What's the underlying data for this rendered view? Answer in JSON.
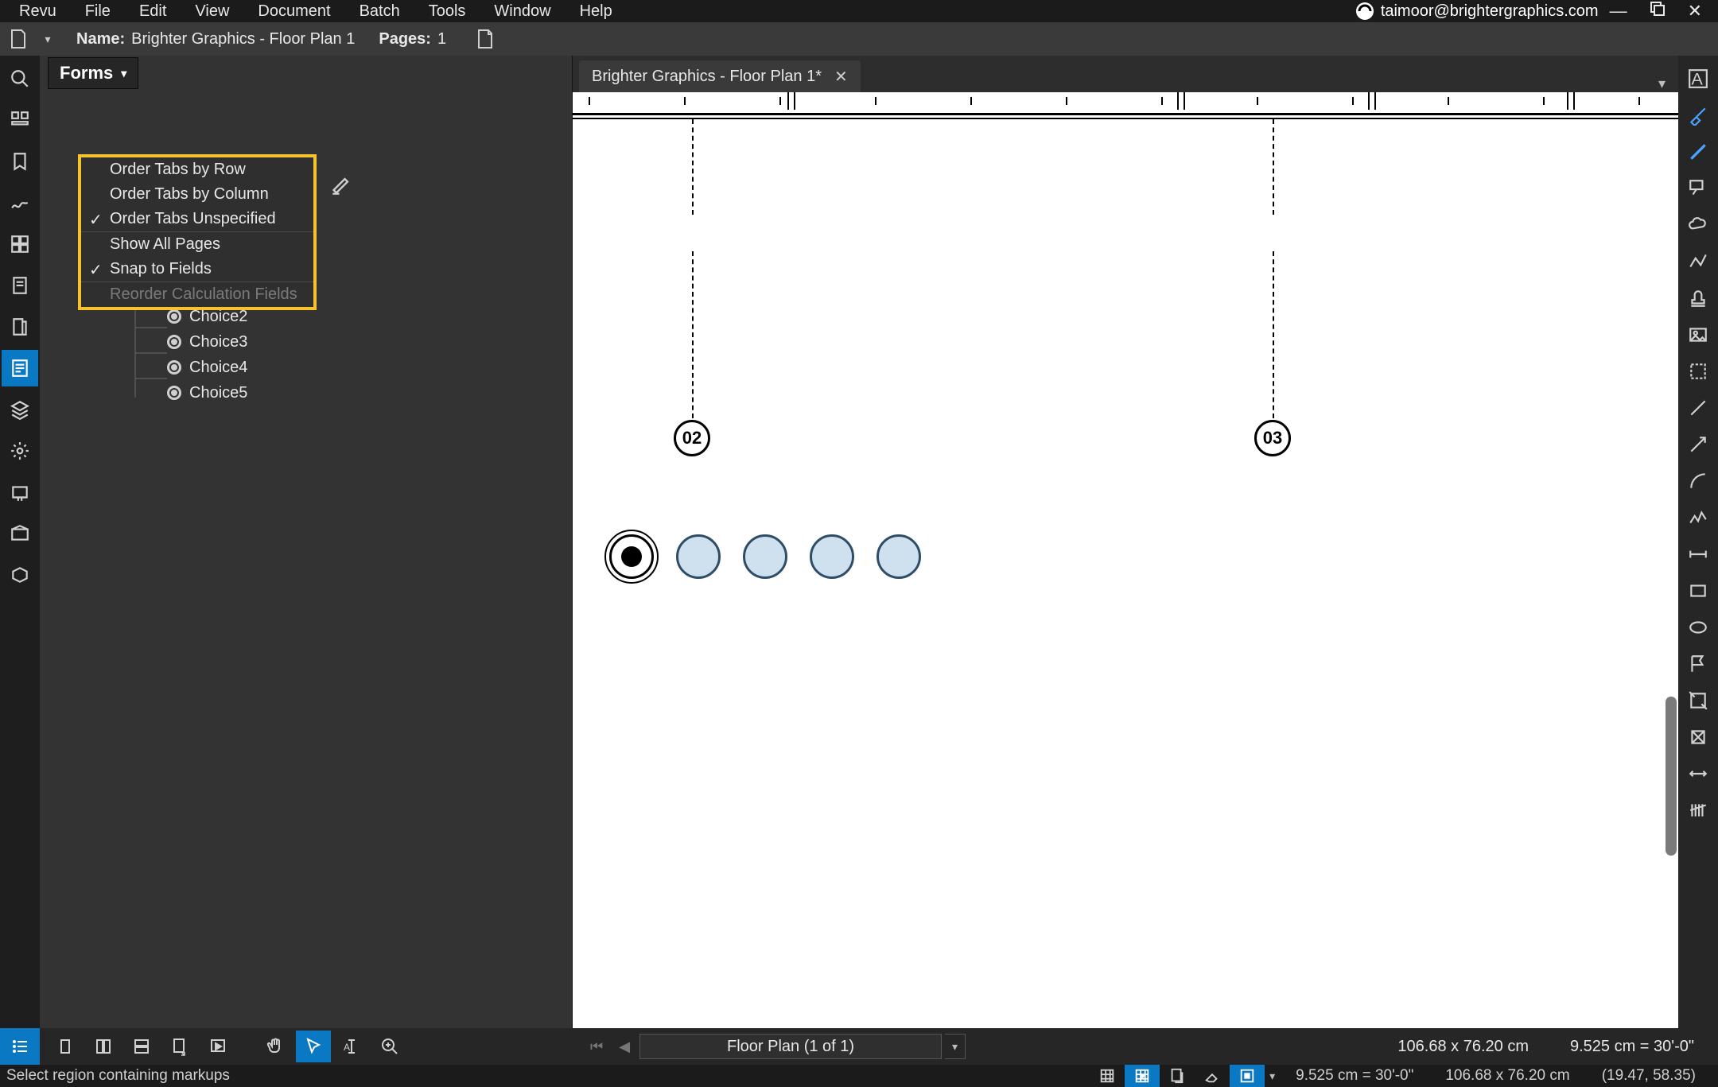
{
  "menubar": {
    "items": [
      "Revu",
      "File",
      "Edit",
      "View",
      "Document",
      "Batch",
      "Tools",
      "Window",
      "Help"
    ],
    "account": "taimoor@brightergraphics.com"
  },
  "docbar": {
    "name_label": "Name:",
    "name_value": "Brighter Graphics - Floor Plan 1",
    "pages_label": "Pages:",
    "pages_value": "1"
  },
  "forms_panel": {
    "button_label": "Forms",
    "dropdown": {
      "order_row": "Order Tabs by Row",
      "order_column": "Order Tabs by Column",
      "order_unspecified": "Order Tabs Unspecified",
      "show_all": "Show All Pages",
      "snap": "Snap to Fields",
      "reorder_calc": "Reorder Calculation Fields"
    },
    "choices": [
      "Choice2",
      "Choice3",
      "Choice4",
      "Choice5"
    ]
  },
  "document": {
    "tab_title": "Brighter Graphics - Floor Plan 1*",
    "anchors": {
      "a": "02",
      "b": "03"
    }
  },
  "viewbar": {
    "page_select": "Floor Plan (1 of 1)",
    "dims": "106.68 x 76.20 cm",
    "scale": "9.525 cm = 30'-0\""
  },
  "statusbar": {
    "hint": "Select region containing markups",
    "scale": "9.525 cm = 30'-0\"",
    "dims": "106.68 x 76.20 cm",
    "coords": "(19.47, 58.35)"
  }
}
